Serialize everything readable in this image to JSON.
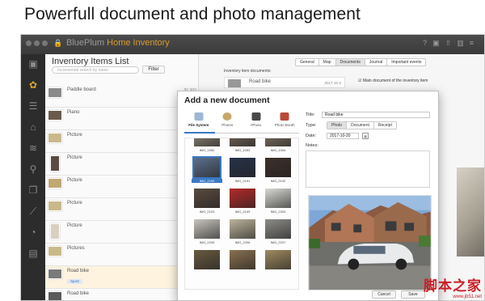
{
  "headline": "Powerfull document and photo management",
  "window": {
    "app_name_prefix": "BluePlum",
    "app_name_suffix": "Home Inventory"
  },
  "sidebar": {
    "icons": [
      "photos-icon",
      "inventory-icon",
      "list-icon",
      "tag-icon",
      "stack-icon",
      "location-icon",
      "documents-icon",
      "chart-icon",
      "pie-chart-icon",
      "clipboard-icon"
    ]
  },
  "list": {
    "title": "Inventory Items List",
    "search_placeholder": "Incremental search by name",
    "filter_label": "Filter",
    "items": [
      {
        "name": "Paddle board",
        "price": "$1,300",
        "tag": ""
      },
      {
        "name": "Piano",
        "price": "",
        "tag": ""
      },
      {
        "name": "Picture",
        "price": "",
        "tag": ""
      },
      {
        "name": "Picture",
        "price": "",
        "tag": ""
      },
      {
        "name": "Picture",
        "price": "",
        "tag": ""
      },
      {
        "name": "Picture",
        "price": "",
        "tag": ""
      },
      {
        "name": "Picture",
        "price": "",
        "tag": ""
      },
      {
        "name": "Pictures",
        "price": "",
        "tag": ""
      },
      {
        "name": "Road bike",
        "price": "$",
        "tag": "Sport"
      },
      {
        "name": "Road bike",
        "price": "",
        "tag": "Sport"
      }
    ]
  },
  "detail": {
    "tabs": [
      "General",
      "Map",
      "Documents",
      "Journal",
      "Important events"
    ],
    "active_tab": "Documents",
    "docs_label": "Inventory item documents:",
    "doc_name": "Road bike",
    "doc_date": "2017-10-2",
    "main_doc_label": "Main document of the inventory item"
  },
  "modal": {
    "title": "Add a new document",
    "sources": [
      "File System",
      "Photos",
      "iPhoto",
      "Photo Booth"
    ],
    "active_source": "File System",
    "images": [
      {
        "name": "IMG_1052",
        "color": "#9a8f7e"
      },
      {
        "name": "IMG_1053",
        "color": "#7b6d5e"
      },
      {
        "name": "IMG_1054",
        "color": "#8a7c6a"
      },
      {
        "name": "IMG_2190",
        "color": "#5b6f8a"
      },
      {
        "name": "IMG_2191",
        "color": "#26324a"
      },
      {
        "name": "IMG_2192",
        "color": "#3d2f2a"
      },
      {
        "name": "IMG_2193",
        "color": "#5a4a3e"
      },
      {
        "name": "IMG_2199",
        "color": "#b42a2a"
      },
      {
        "name": "IMG_2204",
        "color": "#d9d9d4"
      },
      {
        "name": "IMG_2205",
        "color": "#c8c4bd"
      },
      {
        "name": "IMG_2206",
        "color": "#bcb39b"
      },
      {
        "name": "IMG_2207",
        "color": "#8d8c88"
      },
      {
        "name": "",
        "color": "#6a5a40"
      },
      {
        "name": "",
        "color": "#8a7050"
      },
      {
        "name": "",
        "color": "#a08a60"
      }
    ],
    "selected_image": "IMG_2190",
    "title_label": "Title:",
    "title_value": "Road bike",
    "type_label": "Type:",
    "types": [
      "Photo",
      "Document",
      "Receipt"
    ],
    "active_type": "Photo",
    "date_label": "Date:",
    "date_value": "2017-10-20",
    "notes_label": "Notes:",
    "cancel_label": "Cancel",
    "save_label": "Save"
  },
  "watermark": {
    "text": "脚本之家",
    "url": "www.jb51.net"
  }
}
